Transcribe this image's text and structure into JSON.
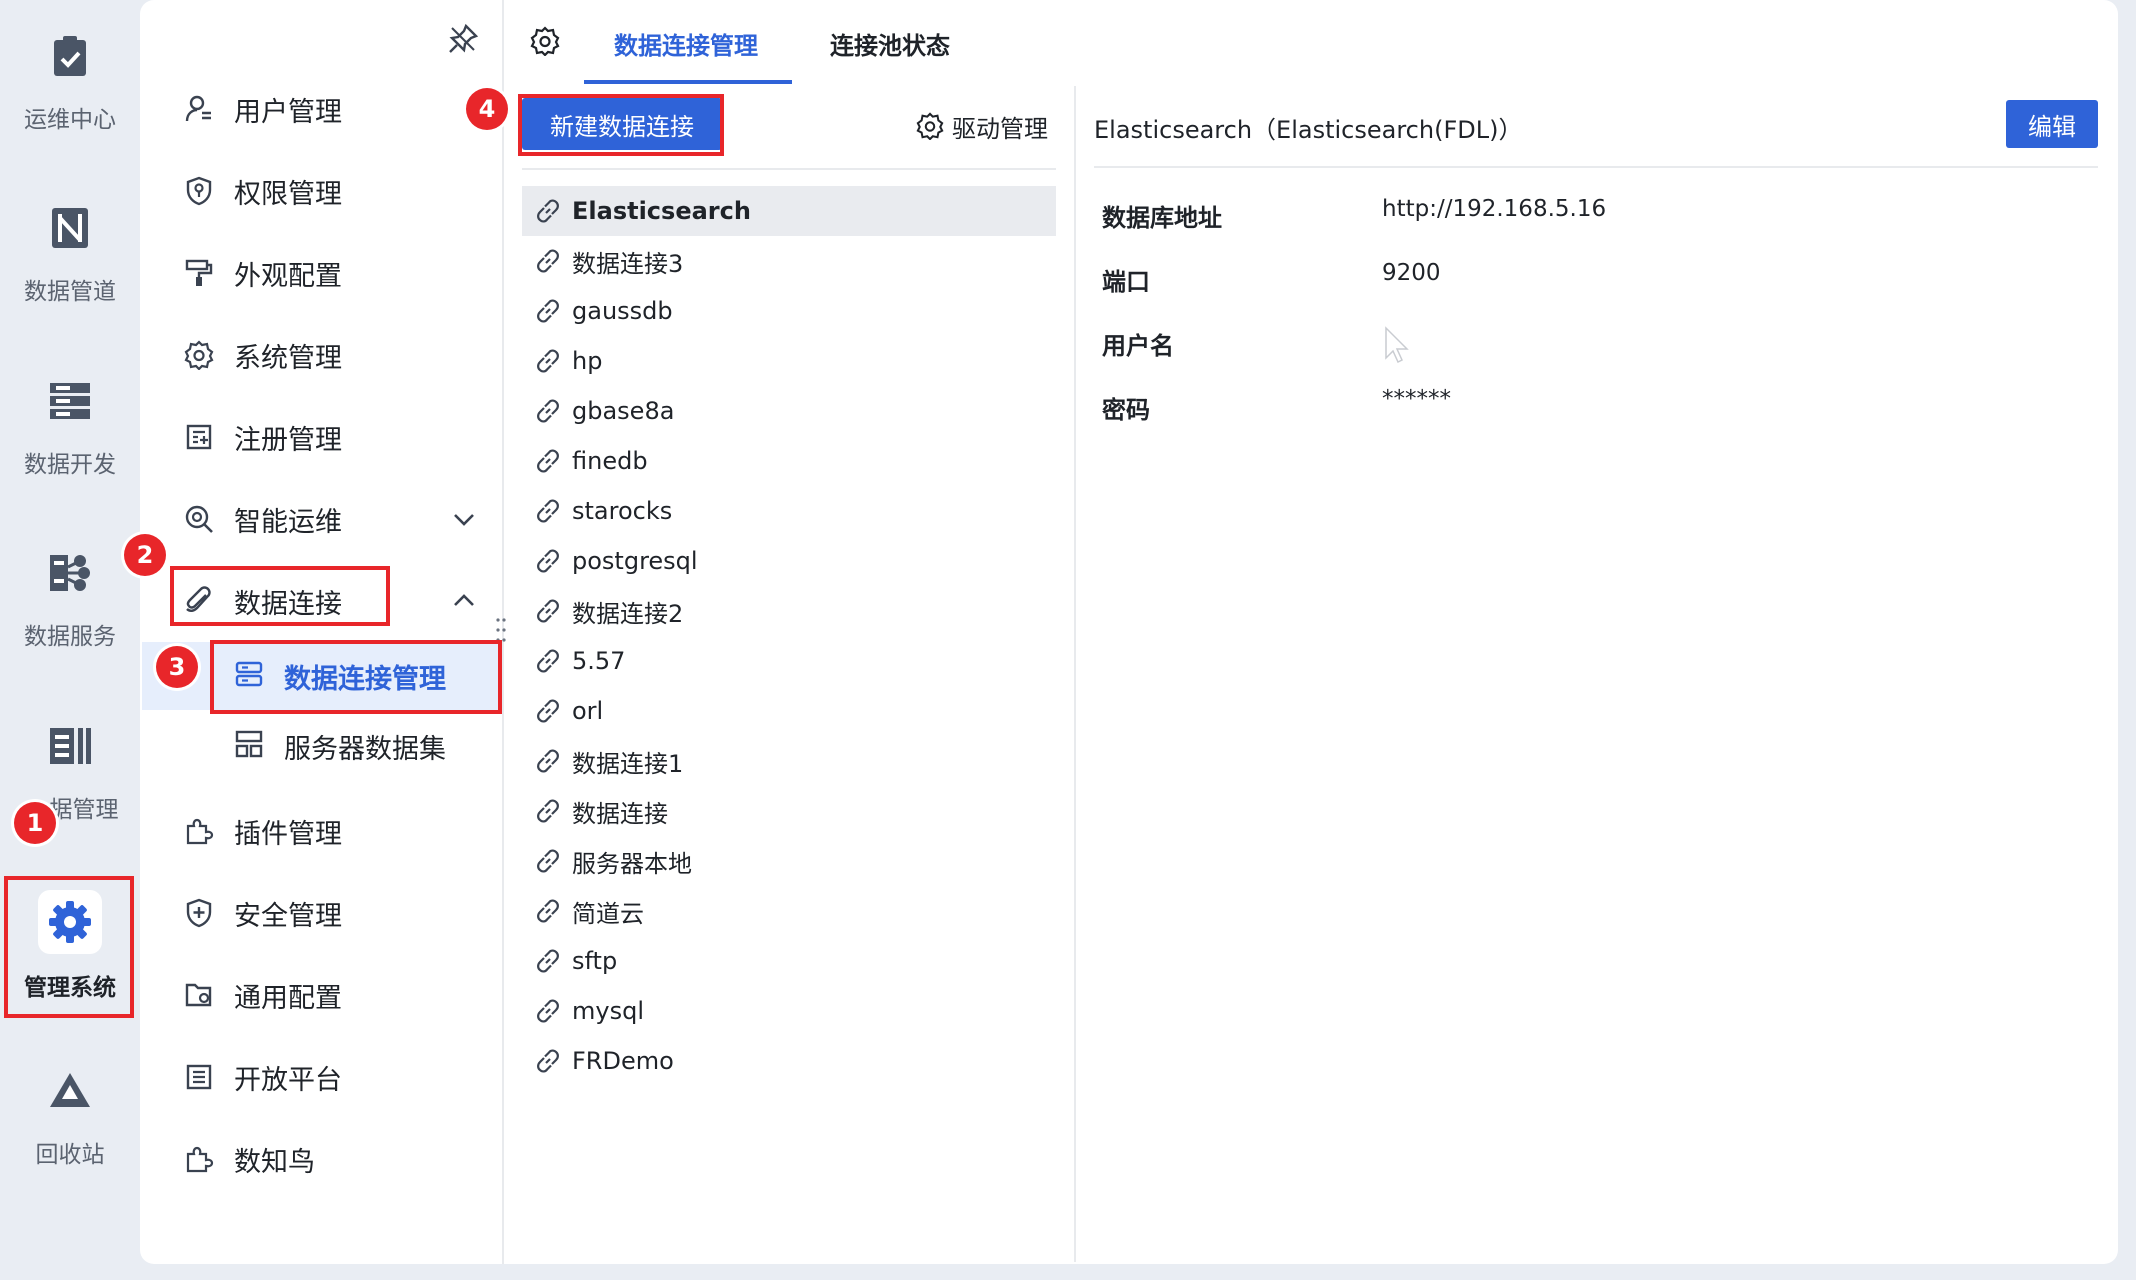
{
  "rail": {
    "items": [
      {
        "label": "运维中心",
        "icon": "clipboard-check-icon"
      },
      {
        "label": "数据管道",
        "icon": "pipeline-icon"
      },
      {
        "label": "数据开发",
        "icon": "server-stack-icon"
      },
      {
        "label": "数据服务",
        "icon": "data-service-icon"
      },
      {
        "label": "据管理",
        "icon": "data-manage-icon"
      },
      {
        "label": "管理系统",
        "icon": "gear-icon"
      },
      {
        "label": "回收站",
        "icon": "recycle-icon"
      }
    ]
  },
  "menu": {
    "items": [
      {
        "label": "用户管理",
        "icon": "user-icon"
      },
      {
        "label": "权限管理",
        "icon": "shield-key-icon"
      },
      {
        "label": "外观配置",
        "icon": "paint-roller-icon"
      },
      {
        "label": "系统管理",
        "icon": "gear-icon"
      },
      {
        "label": "注册管理",
        "icon": "register-icon"
      },
      {
        "label": "智能运维",
        "icon": "smart-ops-icon"
      },
      {
        "label": "数据连接",
        "icon": "paperclip-icon"
      },
      {
        "label": "插件管理",
        "icon": "puzzle-icon"
      },
      {
        "label": "安全管理",
        "icon": "shield-plus-icon"
      },
      {
        "label": "通用配置",
        "icon": "folder-gear-icon"
      },
      {
        "label": "开放平台",
        "icon": "list-icon"
      },
      {
        "label": "数知鸟",
        "icon": "puzzle-icon"
      }
    ],
    "sub_items": [
      {
        "label": "数据连接管理",
        "icon": "db-connection-icon"
      },
      {
        "label": "服务器数据集",
        "icon": "server-dataset-icon"
      }
    ]
  },
  "tabs": [
    {
      "label": "数据连接管理"
    },
    {
      "label": "连接池状态"
    }
  ],
  "toolbar": {
    "new_connection": "新建数据连接",
    "driver_manage": "驱动管理"
  },
  "connections": [
    "Elasticsearch",
    "数据连接3",
    "gaussdb",
    "hp",
    "gbase8a",
    "finedb",
    "starocks",
    "postgresql",
    "数据连接2",
    "5.57",
    "orl",
    "数据连接1",
    "数据连接",
    "服务器本地",
    "简道云",
    "sftp",
    "mysql",
    "FRDemo"
  ],
  "detail": {
    "title": "Elasticsearch（Elasticsearch(FDL)）",
    "edit_label": "编辑",
    "fields": [
      {
        "label": "数据库地址",
        "value": "http://192.168.5.16"
      },
      {
        "label": "端口",
        "value": "9200"
      },
      {
        "label": "用户名",
        "value": ""
      },
      {
        "label": "密码",
        "value": "******"
      }
    ]
  },
  "annotations": [
    "1",
    "2",
    "3",
    "4"
  ],
  "colors": {
    "accent": "#2f63d8",
    "highlight": "#e8262a",
    "selected_bg": "#e9ebef"
  }
}
